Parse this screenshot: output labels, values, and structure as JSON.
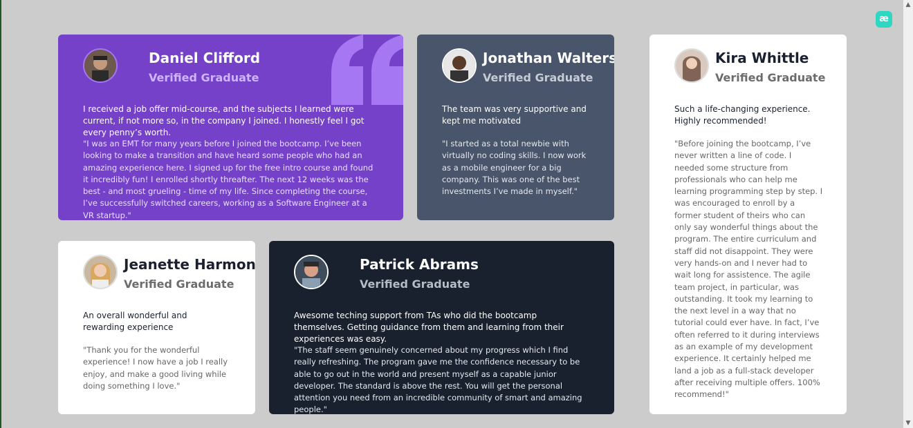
{
  "testimonials": [
    {
      "name": "Daniel Clifford",
      "role": "Verified Graduate",
      "headline": "I received a job offer mid-course, and the subjects I learned were current, if not more so, in the company I joined. I honestly feel I got every penny’s worth.",
      "quote": "\"I was an EMT for many years before I joined the bootcamp. I’ve been looking to make a transition and have heard some people who had an amazing experience here. I signed up for the free intro course and found it incredibly fun! I enrolled shortly threafter. The next 12 weeks was the best - and most grueling - time of my life. Since completing the course, I’ve successfully switched careers, working as a Software Engineer at a VR startup.\""
    },
    {
      "name": "Jonathan Walters",
      "role": "Verified Graduate",
      "headline": "The team was very supportive and kept me motivated",
      "quote": "\"I started as a total newbie with virtually no coding skills. I now work as a mobile engineer for a big company. This was one of the best investments I’ve made in myself.\""
    },
    {
      "name": "Kira Whittle",
      "role": "Verified Graduate",
      "headline": "Such a life-changing experience. Highly recommended!",
      "quote": "\"Before joining the bootcamp, I’ve never written a line of code. I needed some structure from professionals who can help me learning programming step by step. I was encouraged to enroll by a former student of theirs who can only say wonderful things about the program. The entire curriculum and staff did not disappoint. They were very hands-on and I never had to wait long for assistence. The agile team project, in particular, was outstanding. It took my learning to the next level in a way that no tutorial could ever have. In fact, I’ve often referred to it during interviews as an example of my development experience. It certainly helped me land a job as a full-stack developer after receiving multiple offers. 100% recommend!\""
    },
    {
      "name": "Jeanette Harmon",
      "role": "Verified Graduate",
      "headline": "An overall wonderful and rewarding experience",
      "quote": "\"Thank you for the wonderful experience! I now have a job I really enjoy, and make a good living while doing something I love.\""
    },
    {
      "name": "Patrick Abrams",
      "role": "Verified Graduate",
      "headline": "Awesome teching support from TAs who did the bootcamp themselves. Getting guidance from them and learning from their experiences was easy.",
      "quote": "\"The staff seem genuinely concerned about my progress which I find really refreshing. The program gave me the confidence necessary to be able to go out in the world and present myself as a capable junior developer. The standard is above the rest. You will get the personal attention you need from an incredible community of smart and amazing people.\""
    }
  ],
  "colors": {
    "purple": "#7541c8",
    "slate": "#48556a",
    "dark": "#19212e",
    "white": "#ffffff",
    "background": "#cccccc"
  },
  "icons": {
    "quote_mark": "quote-mark-icon",
    "corner_logo": "extension-logo-icon"
  }
}
